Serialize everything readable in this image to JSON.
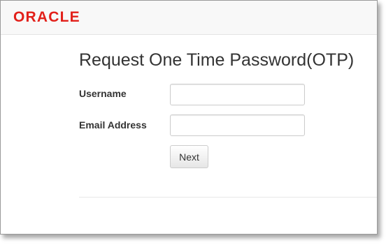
{
  "header": {
    "logo_text": "ORACLE"
  },
  "form": {
    "title": "Request One Time Password(OTP)",
    "username_label": "Username",
    "username_value": "",
    "email_label": "Email Address",
    "email_value": "",
    "next_label": "Next"
  },
  "colors": {
    "brand": "#e2201a",
    "header_bg": "#f8f8f8",
    "text": "#333333"
  }
}
